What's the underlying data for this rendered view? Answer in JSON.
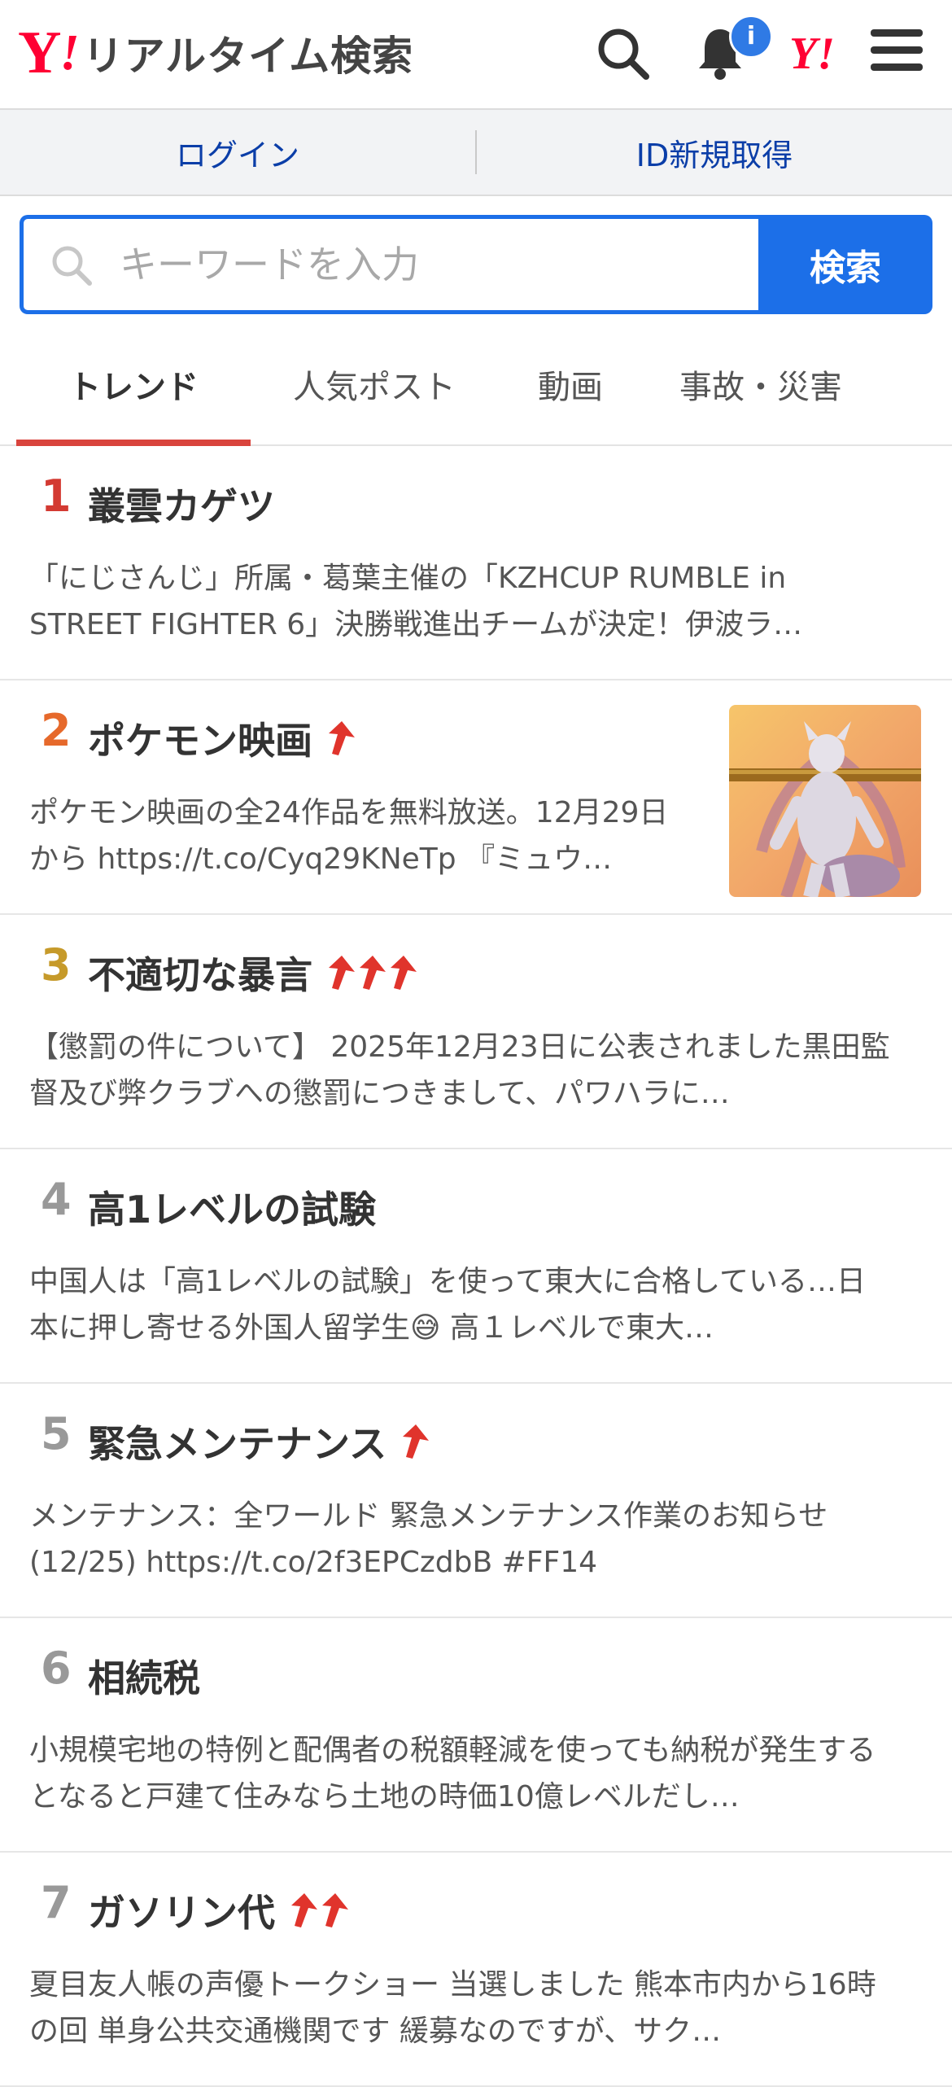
{
  "header": {
    "logo_y": "Y",
    "logo_bang": "!",
    "logo_text": "リアルタイム検索",
    "notification_badge": "i",
    "yjapan_icon_text": "Y!"
  },
  "account": {
    "login": "ログイン",
    "register": "ID新規取得"
  },
  "search": {
    "placeholder": "キーワードを入力",
    "button": "検索"
  },
  "tabs": [
    {
      "label": "トレンド",
      "active": true
    },
    {
      "label": "人気ポスト"
    },
    {
      "label": "動画"
    },
    {
      "label": "事故・災害"
    }
  ],
  "trends": [
    {
      "rank": "1",
      "title": "叢雲カゲツ",
      "arrows": 0,
      "desc": "「にじさんじ」所属・葛葉主催の「KZHCUP RUMBLE in STREET FIGHTER 6」決勝戦進出チームが決定！伊波ラ…"
    },
    {
      "rank": "2",
      "title": "ポケモン映画",
      "arrows": 1,
      "desc": "ポケモン映画の全24作品を無料放送。12月29日から https://t.co/Cyq29KNeTp 『ミュウ…"
    },
    {
      "rank": "3",
      "title": "不適切な暴言",
      "arrows": 3,
      "desc": "【懲罰の件について】 2025年12月23日に公表されました黒田監督及び弊クラブへの懲罰につきまして、パワハラに…"
    },
    {
      "rank": "4",
      "title": "高1レベルの試験",
      "arrows": 0,
      "desc": "中国人は「高1レベルの試験」を使って東大に合格している…日本に押し寄せる外国人留学生😅 高１レベルで東大…"
    },
    {
      "rank": "5",
      "title": "緊急メンテナンス",
      "arrows": 1,
      "desc": "メンテナンス：全ワールド 緊急メンテナンス作業のお知らせ (12/25) https://t.co/2f3EPCzdbB #FF14"
    },
    {
      "rank": "6",
      "title": "相続税",
      "arrows": 0,
      "desc": "小規模宅地の特例と配偶者の税額軽減を使っても納税が発生するとなると戸建て住みなら土地の時価10億レベルだし…"
    },
    {
      "rank": "7",
      "title": "ガソリン代",
      "arrows": 2,
      "desc": "夏目友人帳の声優トークショー󠄀 当選しました󠄀 熊本市内から16時の回 単身公共交通機関です 緩募なのですが、サク…"
    }
  ],
  "colors": {
    "accent": "#1c6fe8",
    "rank1": "#d33a32",
    "rank2": "#e6692b",
    "rank3": "#c69a2a",
    "rank_other": "#999999",
    "trend_arrow": "#e0342c"
  }
}
